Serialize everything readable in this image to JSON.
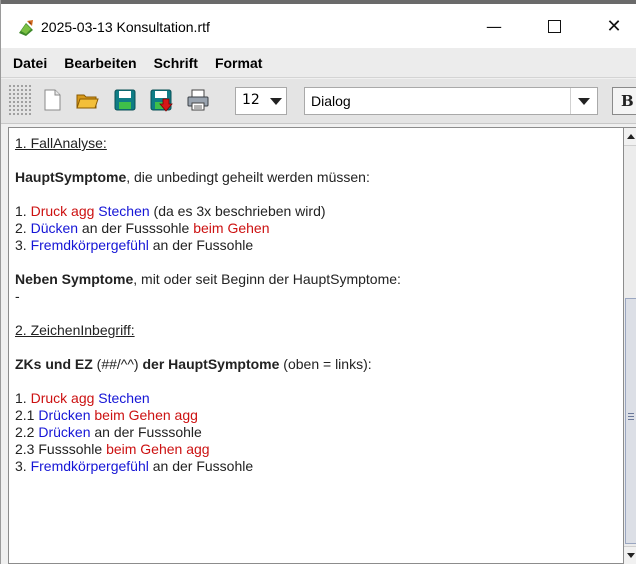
{
  "window": {
    "title": "2025-03-13 Konsultation.rtf",
    "minimize": "—",
    "close": "✕"
  },
  "menubar": {
    "items": [
      "Datei",
      "Bearbeiten",
      "Schrift",
      "Format"
    ]
  },
  "toolbar": {
    "buttons": [
      "new-document-icon",
      "open-folder-icon",
      "save-icon",
      "save-as-icon",
      "print-icon"
    ],
    "font_size": "12",
    "font_name": "Dialog",
    "bold_label": "B"
  },
  "colors": {
    "red": "#cc1111",
    "blue": "#1515d6",
    "text": "#222222"
  },
  "document": {
    "h1": "1. FallAnalyse:",
    "haupt_title": "HauptSymptome",
    "haupt_rest": ", die unbedingt geheilt werden müssen:",
    "l1_num": "1. ",
    "l1_druck": "Druck agg",
    "l1_sp": " ",
    "l1_stechen": "Stechen",
    "l1_rest": " (da es 3x beschrieben wird)",
    "l2_num": "2. ",
    "l2_duecken": "Dücken",
    "l2_mid": " an der Fusssohle ",
    "l2_gehen": "beim Gehen",
    "l3_num": "3. ",
    "l3_fremd": "Fremdkörpergefühl",
    "l3_rest": " an der Fussohle",
    "neben_title": "Neben Symptome",
    "neben_rest": ", mit oder seit Beginn der HauptSymptome:",
    "dash": "-",
    "h2": "2. ZeichenInbegriff:",
    "zk_title": "ZKs und EZ",
    "zk_mid": " (##/^^) ",
    "zk_bold2": "der HauptSymptome",
    "zk_rest": " (oben = links):",
    "m1_num": "1. ",
    "m1_druck": "Druck agg",
    "m1_sp": " ",
    "m1_stechen": "Stechen",
    "m21_num": "2.1  ",
    "m21_druecken": "Drücken",
    "m21_sp": " ",
    "m21_gehen": "beim Gehen agg",
    "m22_num": "2.2  ",
    "m22_druecken": "Drücken",
    "m22_rest": " an der Fusssohle",
    "m23_num": "2.3  Fusssohle ",
    "m23_gehen": "beim Gehen agg",
    "m3_num": "3. ",
    "m3_fremd": "Fremdkörpergefühl",
    "m3_rest": " an der Fussohle"
  }
}
